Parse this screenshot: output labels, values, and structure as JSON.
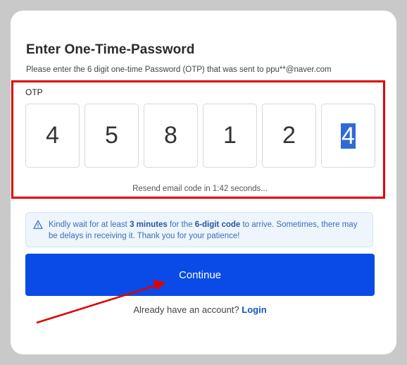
{
  "title": "Enter One-Time-Password",
  "subtitle": "Please enter the 6 digit one-time Password (OTP) that was sent to ppu**@naver.com",
  "otp": {
    "label": "OTP",
    "digits": [
      "4",
      "5",
      "8",
      "1",
      "2",
      "4"
    ],
    "active_index": 5
  },
  "resend_text": "Resend email code in 1:42 seconds...",
  "alert": {
    "icon": "warning-triangle-icon",
    "text_before": "Kindly wait for at least ",
    "bold_1": "3 minutes",
    "text_middle": " for the ",
    "bold_2": "6-digit code",
    "text_after": " to arrive. Sometimes, there may be delays in receiving it. Thank you for your patience!"
  },
  "continue_label": "Continue",
  "login_prompt": "Already have an account?",
  "login_link": "Login",
  "colors": {
    "primary": "#0a4be8",
    "highlight": "#e00000",
    "alert_bg": "#eef5fd"
  }
}
